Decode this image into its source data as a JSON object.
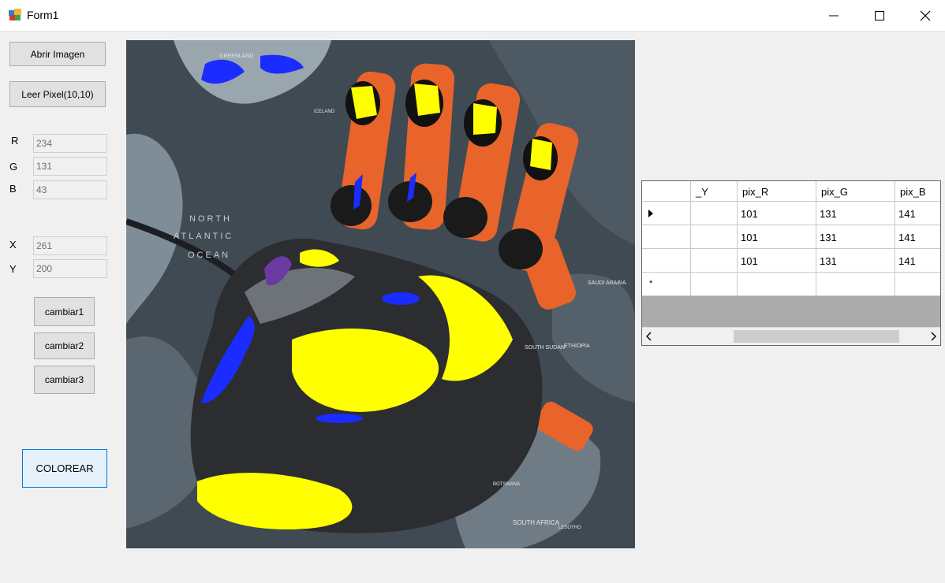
{
  "window": {
    "title": "Form1"
  },
  "buttons": {
    "open_image": "Abrir Imagen",
    "read_pixel": "Leer Pixel(10,10)",
    "change1": "cambiar1",
    "change2": "cambiar2",
    "change3": "cambiar3",
    "colorize": "COLOREAR"
  },
  "fields": {
    "r_label": "R",
    "r_value": "234",
    "g_label": "G",
    "g_value": "131",
    "b_label": "B",
    "b_value": "43",
    "x_label": "X",
    "x_value": "261",
    "y_label": "Y",
    "y_value": "200"
  },
  "grid": {
    "columns": [
      "_Y",
      "pix_R",
      "pix_G",
      "pix_B"
    ],
    "rows": [
      {
        "y": "",
        "r": "101",
        "g": "131",
        "b": "141"
      },
      {
        "y": "",
        "r": "101",
        "g": "131",
        "b": "141"
      },
      {
        "y": "",
        "r": "101",
        "g": "131",
        "b": "141"
      }
    ],
    "new_row_marker": "*"
  },
  "image": {
    "map_labels": [
      "NORTH",
      "ATLANTIC",
      "OCEAN",
      "SOUTH SUDAN",
      "ETHIOPIA",
      "SOUTH AFRICA",
      "SAUDI ARABIA",
      "ICELAND",
      "GREENLAND",
      "BOTSWANA",
      "LESOTHO"
    ]
  },
  "colors": {
    "form_bg": "#f0f0f0",
    "focus_border": "#0078d7",
    "image_orange": "#e8642a",
    "image_yellow": "#ffff00",
    "image_blue": "#1a2cff"
  }
}
